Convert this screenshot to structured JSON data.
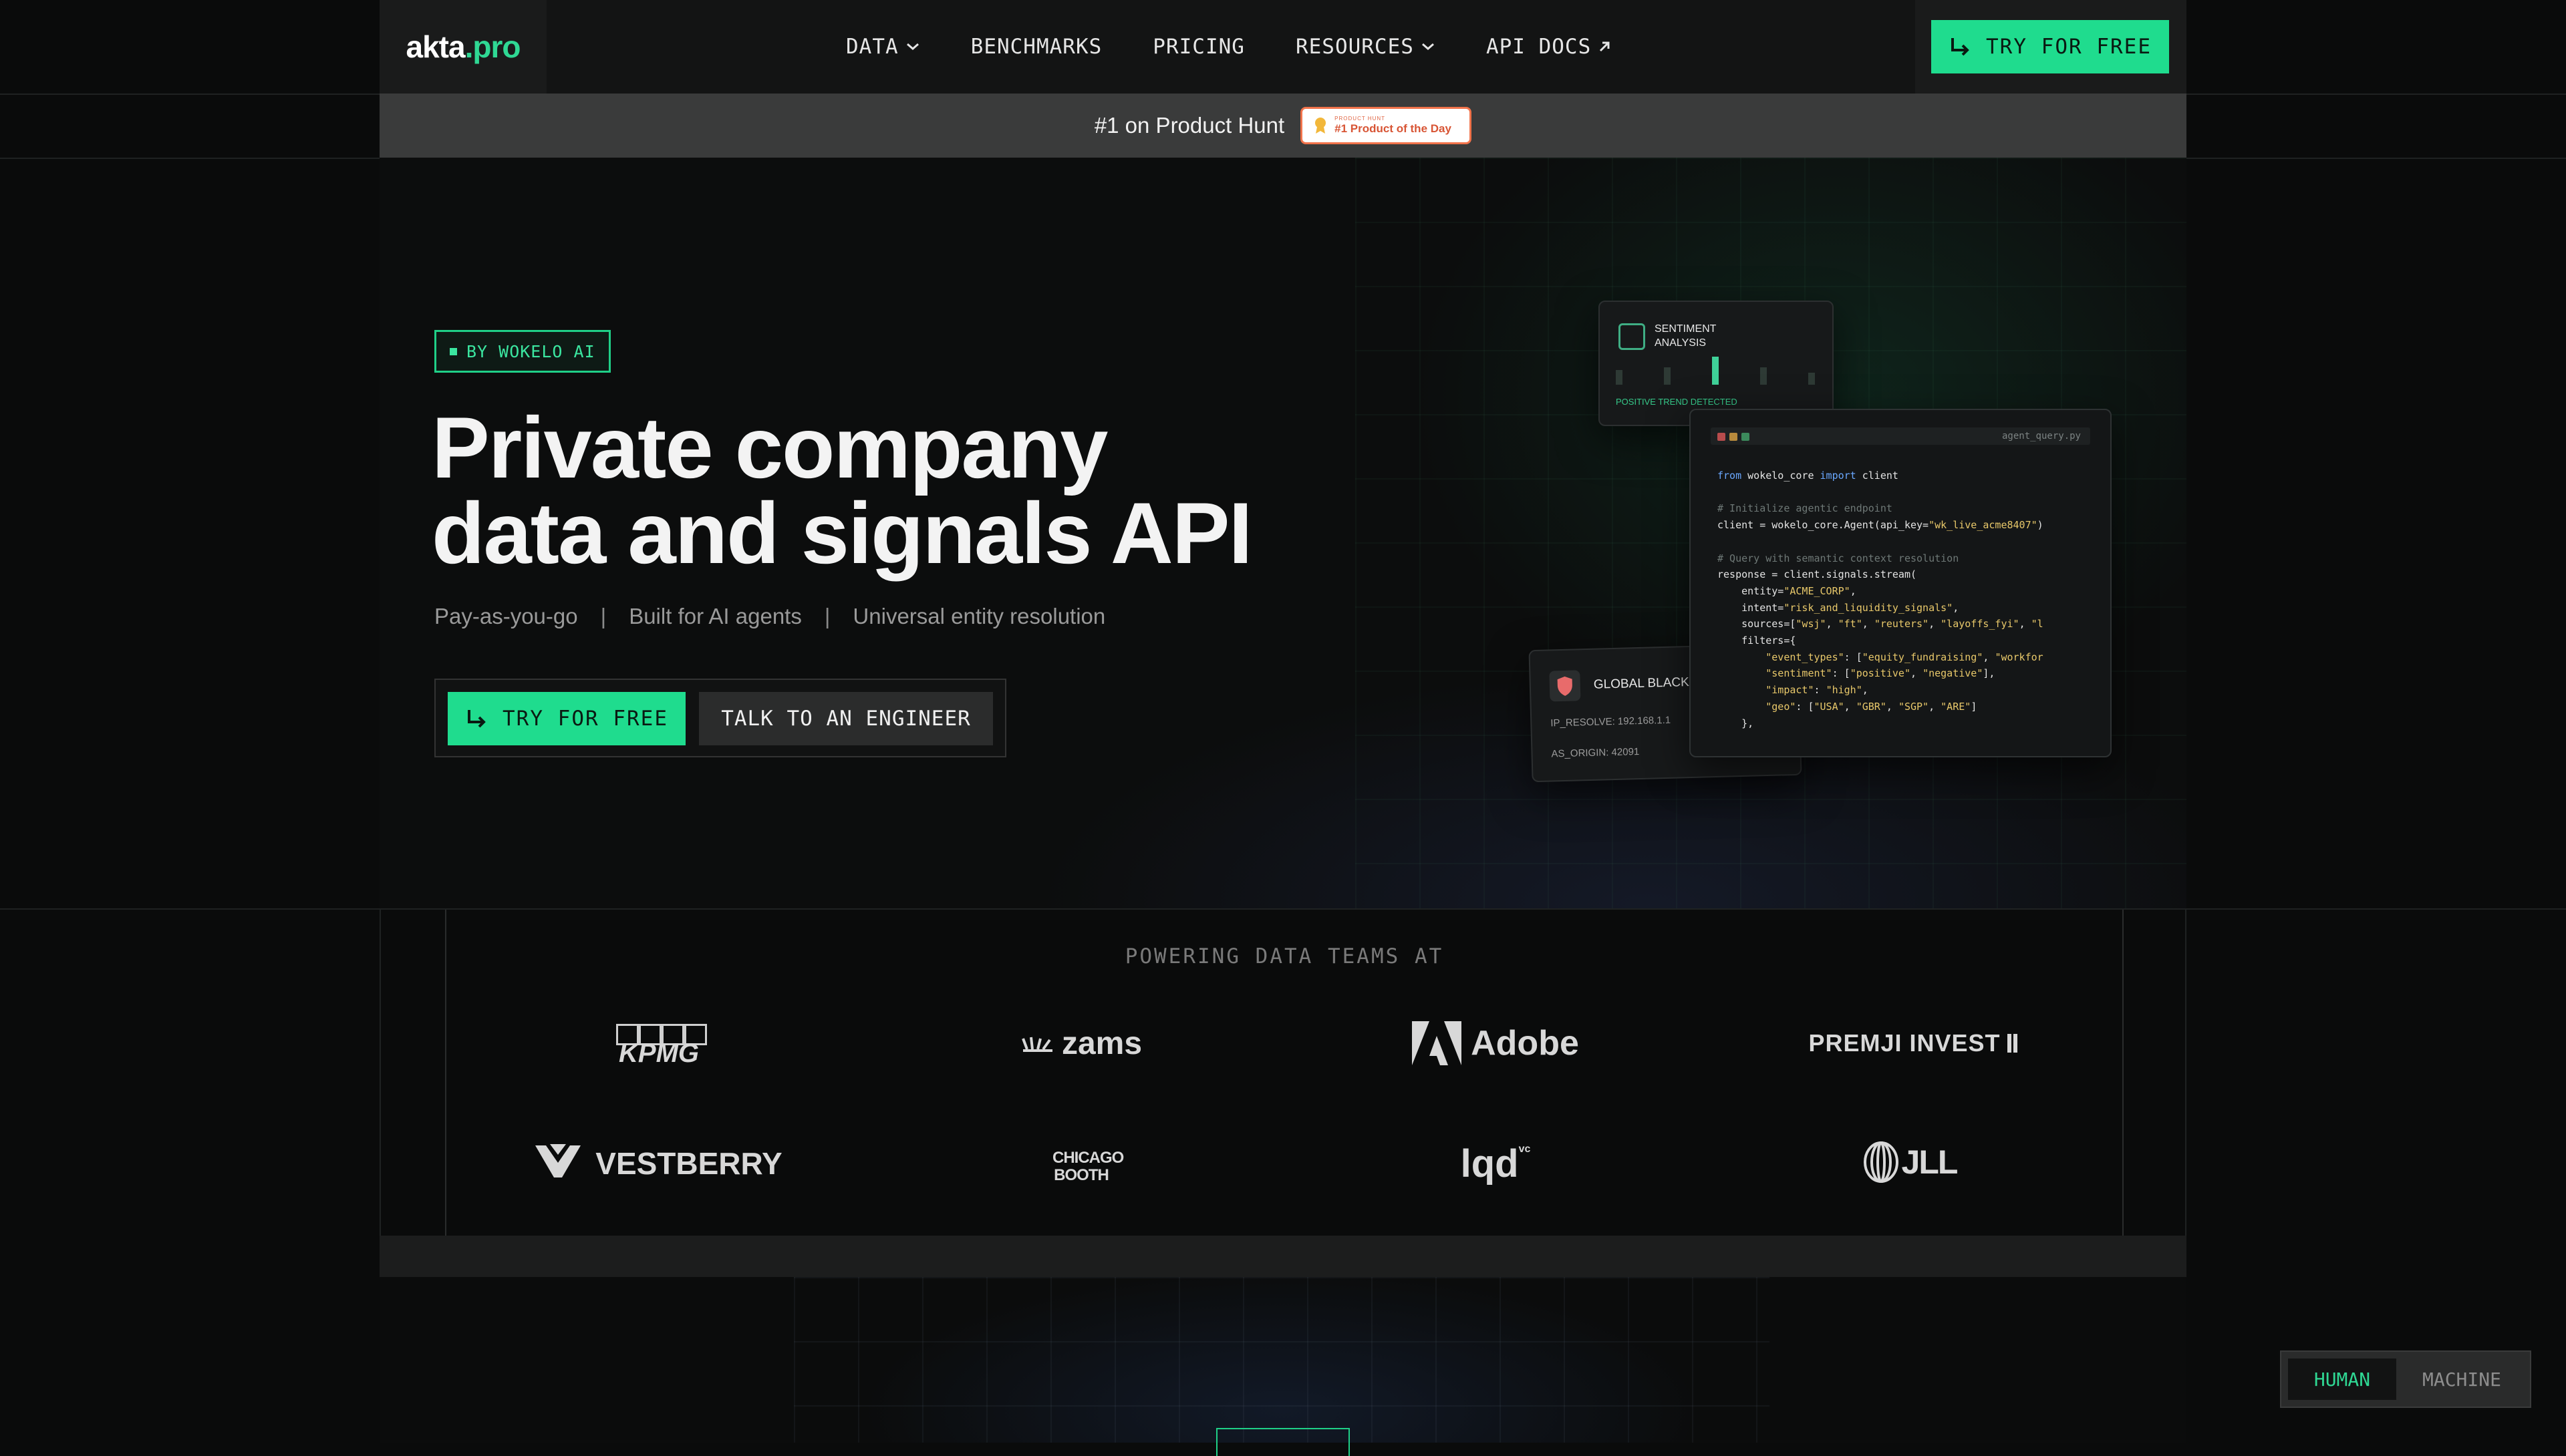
{
  "nav": {
    "logo_part1": "akta",
    "logo_part2": ".pro",
    "items": [
      {
        "label": "DATA",
        "icon": "chevron-down-icon"
      },
      {
        "label": "BENCHMARKS"
      },
      {
        "label": "PRICING"
      },
      {
        "label": "RESOURCES",
        "icon": "chevron-down-icon"
      },
      {
        "label": "API DOCS",
        "icon": "arrow-up-right-icon"
      }
    ],
    "cta_label": "TRY FOR FREE"
  },
  "announcement": {
    "text": "#1 on Product Hunt",
    "badge_small": "PRODUCT HUNT",
    "badge_main": "#1 Product of the Day"
  },
  "hero": {
    "tag": "BY WOKELO AI",
    "headline_line1": "Private company",
    "headline_line2": "data and signals API",
    "features": [
      "Pay-as-you-go",
      "Built for AI agents",
      "Universal entity resolution"
    ],
    "cta_primary": "TRY FOR FREE",
    "cta_secondary": "TALK TO AN ENGINEER"
  },
  "cards": {
    "sentiment": {
      "title_line1": "SENTIMENT",
      "title_line2": "ANALYSIS",
      "footer": "POSITIVE TREND DETECTED"
    },
    "blacklist": {
      "title": "GLOBAL BLACKLI",
      "line1": "IP_RESOLVE: 192.168.1.1",
      "line2": "AS_ORIGIN: 42091"
    },
    "code": {
      "filename": "agent_query.py",
      "lines": [
        "from wokelo_core import client",
        "",
        "# Initialize agentic endpoint",
        "client = wokelo_core.Agent(api_key=\"wk_live_acme8407\")",
        "",
        "# Query with semantic context resolution",
        "response = client.signals.stream(",
        "    entity=\"ACME_CORP\",",
        "    intent=\"risk_and_liquidity_signals\",",
        "    sources=[\"wsj\", \"ft\", \"reuters\", \"layoffs_fyi\", \"l",
        "    filters={",
        "        \"event_types\": [\"equity_fundraising\", \"workfor",
        "        \"sentiment\": [\"positive\", \"negative\"],",
        "        \"impact\": \"high\",",
        "        \"geo\": [\"USA\", \"GBR\", \"SGP\", \"ARE\"]",
        "    },"
      ]
    }
  },
  "logos": {
    "title": "POWERING DATA TEAMS AT",
    "items": [
      "KPMG",
      "zams",
      "Adobe",
      "PREMJI INVEST",
      "VESTBERRY",
      "CHICAGO BOOTH",
      "lqd",
      "JLL"
    ],
    "lqd_sup": "vc"
  },
  "toggle": {
    "human": "HUMAN",
    "machine": "MACHINE",
    "active": "HUMAN"
  },
  "colors": {
    "accent": "#1fdc8e",
    "background": "#0a0b0b",
    "badge_border": "#f1734b"
  }
}
